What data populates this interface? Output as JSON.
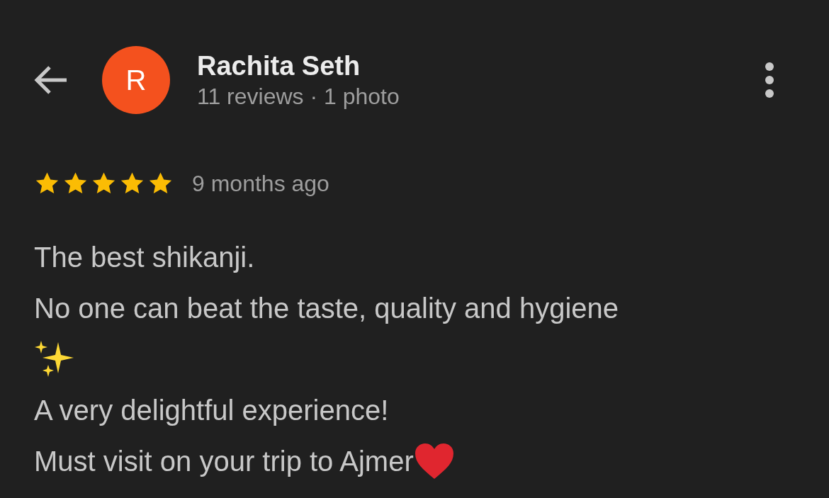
{
  "reviewer": {
    "name": "Rachita Seth",
    "initial": "R",
    "stats": "11 reviews · 1 photo"
  },
  "review": {
    "stars": 5,
    "time": "9 months ago",
    "lines": [
      "The best shikanji.",
      "No one can beat the taste, quality and hygiene",
      "A very delightful experience!",
      "Must visit on your trip to Ajmer"
    ]
  }
}
